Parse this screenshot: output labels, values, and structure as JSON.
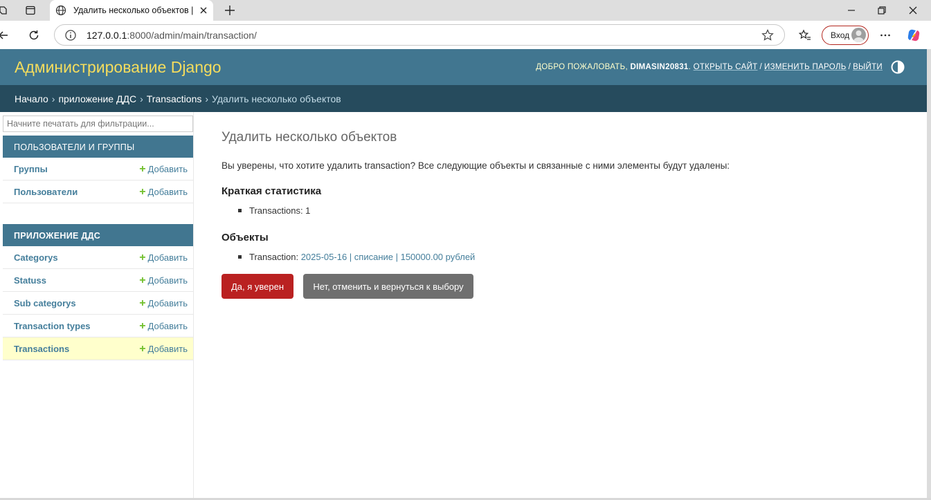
{
  "browser": {
    "tab_title": "Удалить несколько объектов | А",
    "url_host": "127.0.0.1",
    "url_rest": ":8000/admin/main/transaction/",
    "login_label": "Вход"
  },
  "header": {
    "branding": "Администрирование Django",
    "welcome": "ДОБРО ПОЖАЛОВАТЬ,",
    "username": "DIMASIN20831",
    "links": {
      "view_site": "ОТКРЫТЬ САЙТ",
      "change_password": "ИЗМЕНИТЬ ПАРОЛЬ",
      "logout": "ВЫЙТИ"
    },
    "separator": "/"
  },
  "breadcrumbs": {
    "home": "Начало",
    "app": "приложение ДДС",
    "model": "Transactions",
    "current": "Удалить несколько объектов",
    "arrow": "›"
  },
  "sidebar": {
    "filter_placeholder": "Начните печатать для фильтрации...",
    "add_label": "Добавить",
    "modules": [
      {
        "caption": "ПОЛЬЗОВАТЕЛИ И ГРУППЫ",
        "models": [
          "Группы",
          "Пользователи"
        ]
      },
      {
        "caption": "ПРИЛОЖЕНИЕ ДДС",
        "models": [
          "Categorys",
          "Statuss",
          "Sub categorys",
          "Transaction types",
          "Transactions"
        ]
      }
    ]
  },
  "content": {
    "title": "Удалить несколько объектов",
    "lead": "Вы уверены, что хотите удалить transaction? Все следующие объекты и связанные с ними элементы будут удалены:",
    "summary_heading": "Краткая статистика",
    "summary_item": "Transactions: 1",
    "objects_heading": "Объекты",
    "object_prefix": "Transaction:",
    "object_link": "2025-05-16 | списание | 150000.00 рублей",
    "confirm_button": "Да, я уверен",
    "cancel_button": "Нет, отменить и вернуться к выбору"
  },
  "colors": {
    "header_bg": "#417690",
    "breadcrumbs_bg": "#264b5d",
    "branding": "#f5dd5d",
    "link": "#447e9b",
    "danger": "#ba2121",
    "current_row": "#ffffcc"
  }
}
